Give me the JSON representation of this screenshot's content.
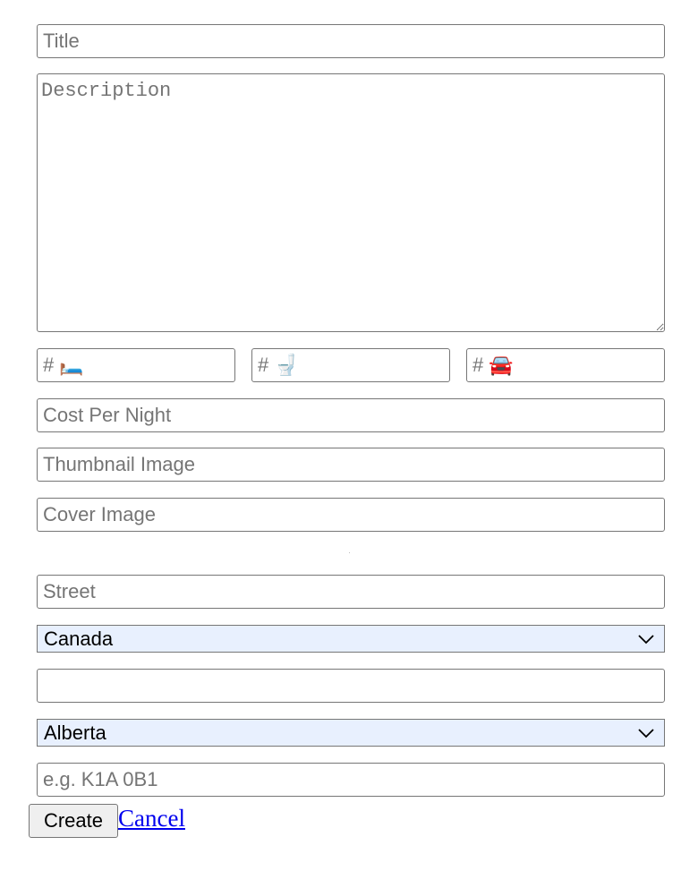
{
  "form": {
    "title": {
      "placeholder": "Title",
      "value": ""
    },
    "description": {
      "placeholder": "Description",
      "value": ""
    },
    "bedrooms": {
      "placeholder": "# 🛏️",
      "value": ""
    },
    "bathrooms": {
      "placeholder": "# 🚽",
      "value": ""
    },
    "parking": {
      "placeholder": "# 🚘",
      "value": ""
    },
    "cost_per_night": {
      "placeholder": "Cost Per Night",
      "value": ""
    },
    "thumbnail_image": {
      "placeholder": "Thumbnail Image",
      "value": ""
    },
    "cover_image": {
      "placeholder": "Cover Image",
      "value": ""
    },
    "street": {
      "placeholder": "Street",
      "value": ""
    },
    "country": {
      "selected": "Canada"
    },
    "city": {
      "placeholder": "",
      "value": ""
    },
    "province": {
      "selected": "Alberta"
    },
    "postal_code": {
      "placeholder": "e.g. K1A 0B1",
      "value": ""
    }
  },
  "actions": {
    "create_label": "Create",
    "cancel_label": "Cancel"
  },
  "colors": {
    "select_background": "#e8f0fe",
    "link": "#0000ee",
    "border": "#767676",
    "placeholder": "#757575"
  },
  "icons": {
    "select_chevron": "chevron-down-icon"
  }
}
